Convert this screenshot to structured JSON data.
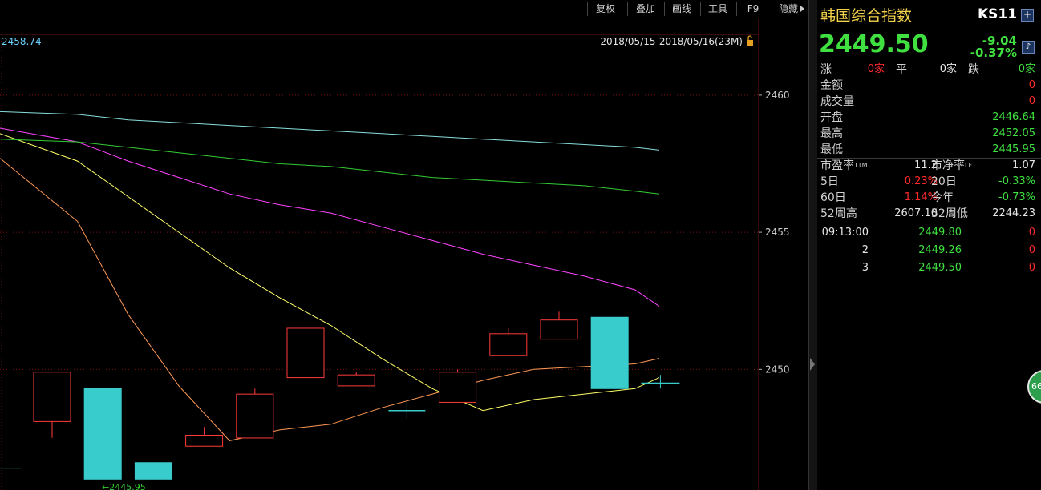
{
  "toolbar": {
    "items": [
      "复权",
      "叠加",
      "画线",
      "工具",
      "F9",
      "隐藏"
    ]
  },
  "chart_header": {
    "left_label": "2458.74",
    "date_range": "2018/05/15-2018/05/16(23M)"
  },
  "colors": {
    "up": "#ff3a3a",
    "down": "#39cccc",
    "grid": "#7a1010",
    "axis_text": "#cccccc",
    "ma1": "#ffff66",
    "ma2": "#ff9955",
    "ma3": "#ff44ff",
    "ma4": "#33cc33",
    "ma5": "#88dddd"
  },
  "chart_data": {
    "type": "candlestick",
    "y_ticks": [
      2450,
      2455,
      2460
    ],
    "ylim": [
      2445.6,
      2462.8
    ],
    "candles": [
      {
        "o": 2448.1,
        "c": 2449.9,
        "h": 2449.9,
        "l": 2447.5
      },
      {
        "o": 2449.3,
        "c": 2446.0,
        "h": 2449.3,
        "l": 2446.0
      },
      {
        "o": 2446.6,
        "c": 2446.0,
        "h": 2446.6,
        "l": 2446.0
      },
      {
        "o": 2447.2,
        "c": 2447.6,
        "h": 2447.9,
        "l": 2447.2
      },
      {
        "o": 2447.5,
        "c": 2449.1,
        "h": 2449.3,
        "l": 2447.5
      },
      {
        "o": 2449.7,
        "c": 2451.5,
        "h": 2451.5,
        "l": 2449.7
      },
      {
        "o": 2449.4,
        "c": 2449.8,
        "h": 2449.9,
        "l": 2449.4
      },
      {
        "o": 2448.5,
        "c": 2448.5,
        "h": 2448.8,
        "l": 2448.2
      },
      {
        "o": 2448.8,
        "c": 2449.9,
        "h": 2450.0,
        "l": 2448.8
      },
      {
        "o": 2450.5,
        "c": 2451.3,
        "h": 2451.5,
        "l": 2450.5
      },
      {
        "o": 2451.1,
        "c": 2451.8,
        "h": 2452.1,
        "l": 2451.1
      },
      {
        "o": 2451.9,
        "c": 2449.3,
        "h": 2451.9,
        "l": 2449.3
      },
      {
        "o": 2449.5,
        "c": 2449.5,
        "h": 2449.8,
        "l": 2449.3
      }
    ],
    "left_tail_value": 2446.4,
    "low_marker": {
      "value": 2445.95,
      "text": "←2445.95"
    },
    "ma_lines": [
      {
        "values": [
          2458.6,
          2457.6,
          2456.3,
          2455.0,
          2453.7,
          2452.6,
          2451.6,
          2450.4,
          2449.3,
          2448.5,
          2448.9,
          2449.1,
          2449.3,
          2449.7
        ]
      },
      {
        "values": [
          2457.7,
          2455.4,
          2452.0,
          2449.4,
          2447.4,
          2447.8,
          2448.0,
          2448.6,
          2449.1,
          2449.6,
          2450.0,
          2450.1,
          2450.2,
          2450.4
        ]
      },
      {
        "values": [
          2458.8,
          2458.3,
          2457.6,
          2457.0,
          2456.4,
          2456.0,
          2455.7,
          2455.2,
          2454.7,
          2454.2,
          2453.8,
          2453.4,
          2452.9,
          2452.3
        ]
      },
      {
        "values": [
          2458.4,
          2458.3,
          2458.1,
          2457.9,
          2457.7,
          2457.5,
          2457.4,
          2457.2,
          2457.0,
          2456.9,
          2456.8,
          2456.7,
          2456.5,
          2456.4
        ]
      },
      {
        "values": [
          2459.4,
          2459.3,
          2459.1,
          2459.0,
          2458.9,
          2458.8,
          2458.7,
          2458.6,
          2458.5,
          2458.4,
          2458.3,
          2458.2,
          2458.1,
          2458.0
        ]
      }
    ]
  },
  "quote": {
    "name": "韩国综合指数",
    "code": "KS11",
    "price": "2449.50",
    "change": "-9.04",
    "change_pct": "-0.37%",
    "add_icon": "plus-icon",
    "bell_icon": "bell-icon",
    "breadth": {
      "up_label": "涨",
      "up_val": "0家",
      "flat_label": "平",
      "flat_val": "0家",
      "down_label": "跌",
      "down_val": "0家"
    },
    "stats": [
      {
        "label": "金额",
        "value": "0"
      },
      {
        "label": "成交量",
        "value": "0"
      },
      {
        "label": "开盘",
        "value": "2446.64"
      },
      {
        "label": "最高",
        "value": "2452.05"
      },
      {
        "label": "最低",
        "value": "2445.95"
      }
    ],
    "ratios": {
      "pe_label": "市盈率",
      "pe_sup": "TTM",
      "pe_val": "11.2",
      "pb_label": "市净率",
      "pb_sup": "LF",
      "pb_val": "1.07",
      "d5_label": "5日",
      "d5_val": "0.23%",
      "d20_label": "20日",
      "d20_val": "-0.33%",
      "d60_label": "60日",
      "d60_val": "1.14%",
      "ytd_label": "今年",
      "ytd_val": "-0.73%",
      "w52h_label": "52周高",
      "w52h_val": "2607.10",
      "w52l_label": "52周低",
      "w52l_val": "2244.23"
    },
    "ticks": [
      {
        "time": "09:13:00",
        "price": "2449.80",
        "vol": "0"
      },
      {
        "time": "2",
        "price": "2449.26",
        "vol": "0"
      },
      {
        "time": "3",
        "price": "2449.50",
        "vol": "0"
      }
    ]
  },
  "badge": "66"
}
